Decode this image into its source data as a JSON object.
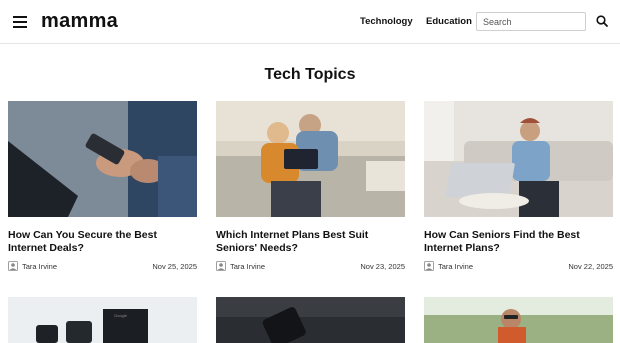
{
  "header": {
    "logo": "mamma",
    "nav": [
      "Technology",
      "Education"
    ],
    "search_placeholder": "Search"
  },
  "section_title": "Tech Topics",
  "articles": [
    {
      "title": "How Can You Secure the Best Internet Deals?",
      "author": "Tara Irvine",
      "date": "Nov 25, 2025",
      "image": "hands holding smartphone near laptop"
    },
    {
      "title": "Which Internet Plans Best Suit Seniors' Needs?",
      "author": "Tara Irvine",
      "date": "Nov 23, 2025",
      "image": "senior couple with tablet on sofa"
    },
    {
      "title": "How Can Seniors Find the Best Internet Plans?",
      "author": "Tara Irvine",
      "date": "Nov 22, 2025",
      "image": "senior woman with laptop on sofa"
    },
    {
      "title": "",
      "author": "",
      "date": "",
      "image": "phones and product box"
    },
    {
      "title": "",
      "author": "",
      "date": "",
      "image": "hand holding phone"
    },
    {
      "title": "",
      "author": "",
      "date": "",
      "image": "man with glasses outdoors"
    }
  ],
  "colors": {
    "text": "#111111",
    "border": "#e6e6e6"
  },
  "icons": [
    "menu-icon",
    "search-icon",
    "author-icon"
  ]
}
